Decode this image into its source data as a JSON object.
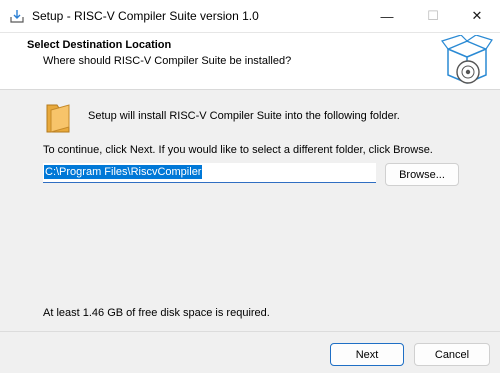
{
  "window": {
    "title": "Setup - RISC-V Compiler Suite version 1.0",
    "minimize_glyph": "—",
    "maximize_glyph": "☐",
    "close_glyph": "✕"
  },
  "header": {
    "title": "Select Destination Location",
    "subtitle": "Where should RISC-V Compiler Suite be installed?",
    "image": "setup-box-disc-icon"
  },
  "body": {
    "folder_icon": "folder-icon",
    "info_text": "Setup will install RISC-V Compiler Suite into the following folder.",
    "instruction_text": "To continue, click Next. If you would like to select a different folder, click Browse.",
    "path_value": "C:\\Program Files\\RiscvCompiler",
    "browse_label": "Browse...",
    "disk_space_text": "At least 1.46 GB of free disk space is required."
  },
  "footer": {
    "next_label": "Next",
    "cancel_label": "Cancel"
  }
}
